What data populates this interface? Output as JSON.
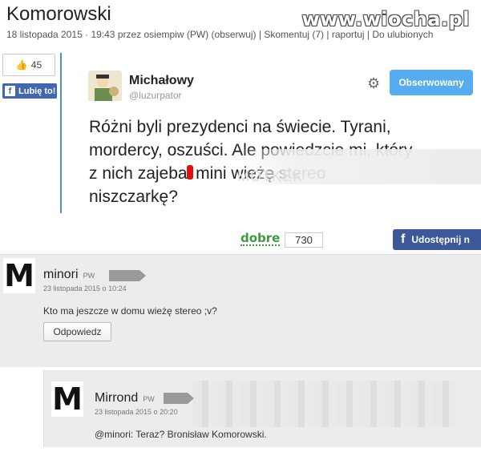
{
  "header": {
    "title": "Komorowski",
    "date": "18 listopada 2015",
    "time": "19:43",
    "przez": "przez",
    "author": "osiempiw",
    "author_badge": "(PW)",
    "observe": "(obserwuj)",
    "comments": "Skomentuj (7)",
    "report": "raportuj",
    "favorites": "Do ulubionych",
    "watermark": "www.wiocha.pl"
  },
  "likes": {
    "count": "45",
    "button_label": "Lubię to!"
  },
  "tweet": {
    "name": "Michałowy",
    "handle": "@luzurpator",
    "follow_label": "Obserwowany",
    "text_line1": "Różni byli prezydenci na świecie. Tyrani,",
    "text_line2": "mordercy, oszuści. Ale powiedzcie mi, który",
    "text_line3": "z nich zajebał mini wieżę stereo",
    "text_line4": "niszczarkę?",
    "hidden_overlay": "MOTKEK"
  },
  "actions": {
    "dobre_label": "dobre",
    "votes": "730",
    "share_label": "Udostępnij n"
  },
  "comments": [
    {
      "name": "minori",
      "badge": "PW",
      "date": "23 listopada 2015 o 10:24",
      "text": "Kto ma jeszcze w domu wieżę stereo ;v?",
      "reply_label": "Odpowiedz"
    },
    {
      "name": "Mirrond",
      "badge": "PW",
      "date": "23 listopada 2015 o 20:20",
      "text": "@minori: Teraz? Bronisław Komorowski."
    }
  ],
  "colors": {
    "twitter_blue": "#55acee",
    "facebook_blue": "#3b5998",
    "dobre_green": "#3c9a3c"
  }
}
